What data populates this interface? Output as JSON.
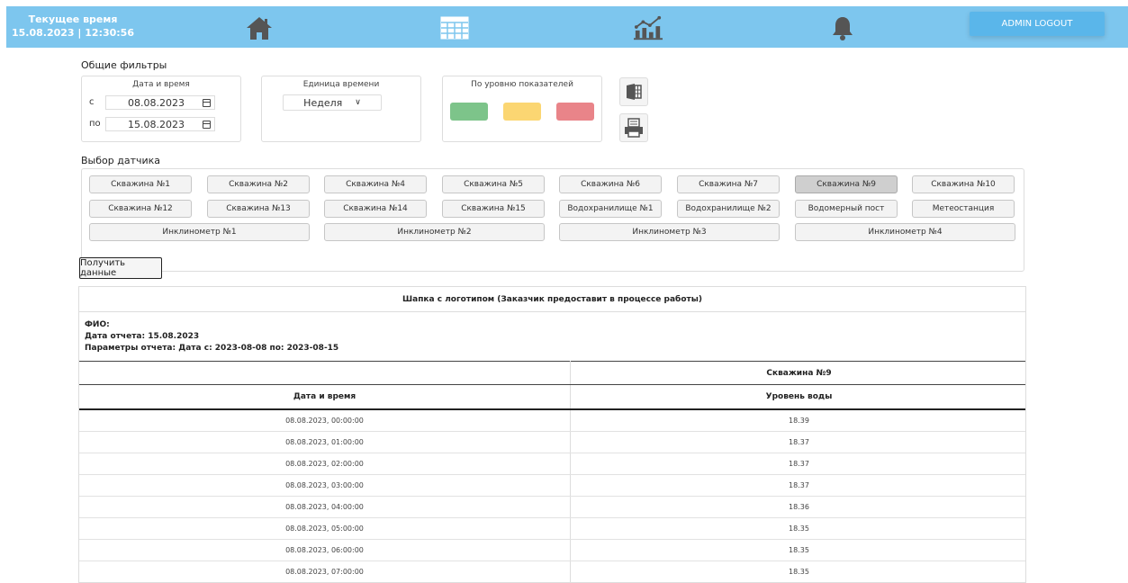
{
  "header": {
    "clock_label": "Текущее время",
    "clock_value": "15.08.2023 | 12:30:56",
    "logout_label": "ADMIN LOGOUT",
    "icons": [
      "home-icon",
      "table-icon",
      "chart-icon",
      "bell-icon"
    ],
    "bg_color": "#7dc6ee"
  },
  "filters": {
    "title": "Общие фильтры",
    "date_box_title": "Дата и время",
    "from_label": "с",
    "from_value": "08.08.2023",
    "to_label": "по",
    "to_value": "15.08.2023",
    "unit_box_title": "Единица времени",
    "unit_value": "Неделя",
    "level_box_title": "По уровню показателей",
    "level_colors": [
      "#7dc48a",
      "#fbd672",
      "#e98489"
    ]
  },
  "sensors": {
    "title": "Выбор датчика",
    "row1": [
      "Скважина №1",
      "Скважина №2",
      "Скважина №4",
      "Скважина №5",
      "Скважина №6",
      "Скважина №7",
      "Скважина №9",
      "Скважина №10"
    ],
    "row2": [
      "Скважина №12",
      "Скважина №13",
      "Скважина №14",
      "Скважина №15",
      "Водохранилище №1",
      "Водохранилище №2",
      "Водомерный пост",
      "Метеостанция"
    ],
    "row3": [
      "Инклинометр №1",
      "Инклинометр №2",
      "Инклинометр №3",
      "Инклинометр №4"
    ],
    "active": "Скважина №9"
  },
  "get_data_label": "Получить данные",
  "report": {
    "header": "Шапка с логотипом (Заказчик предоставит в процессе работы)",
    "fio": "ФИО:",
    "report_date": "Дата отчета: 15.08.2023",
    "params": "Параметры отчета: Дата с: 2023-08-08 по: 2023-08-15",
    "sensor_name": "Скважина №9",
    "col_datetime": "Дата и время",
    "col_level": "Уровень воды",
    "rows": [
      {
        "dt": "08.08.2023, 00:00:00",
        "level": "18.39"
      },
      {
        "dt": "08.08.2023, 01:00:00",
        "level": "18.37"
      },
      {
        "dt": "08.08.2023, 02:00:00",
        "level": "18.37"
      },
      {
        "dt": "08.08.2023, 03:00:00",
        "level": "18.37"
      },
      {
        "dt": "08.08.2023, 04:00:00",
        "level": "18.36"
      },
      {
        "dt": "08.08.2023, 05:00:00",
        "level": "18.35"
      },
      {
        "dt": "08.08.2023, 06:00:00",
        "level": "18.35"
      },
      {
        "dt": "08.08.2023, 07:00:00",
        "level": "18.35"
      }
    ]
  }
}
